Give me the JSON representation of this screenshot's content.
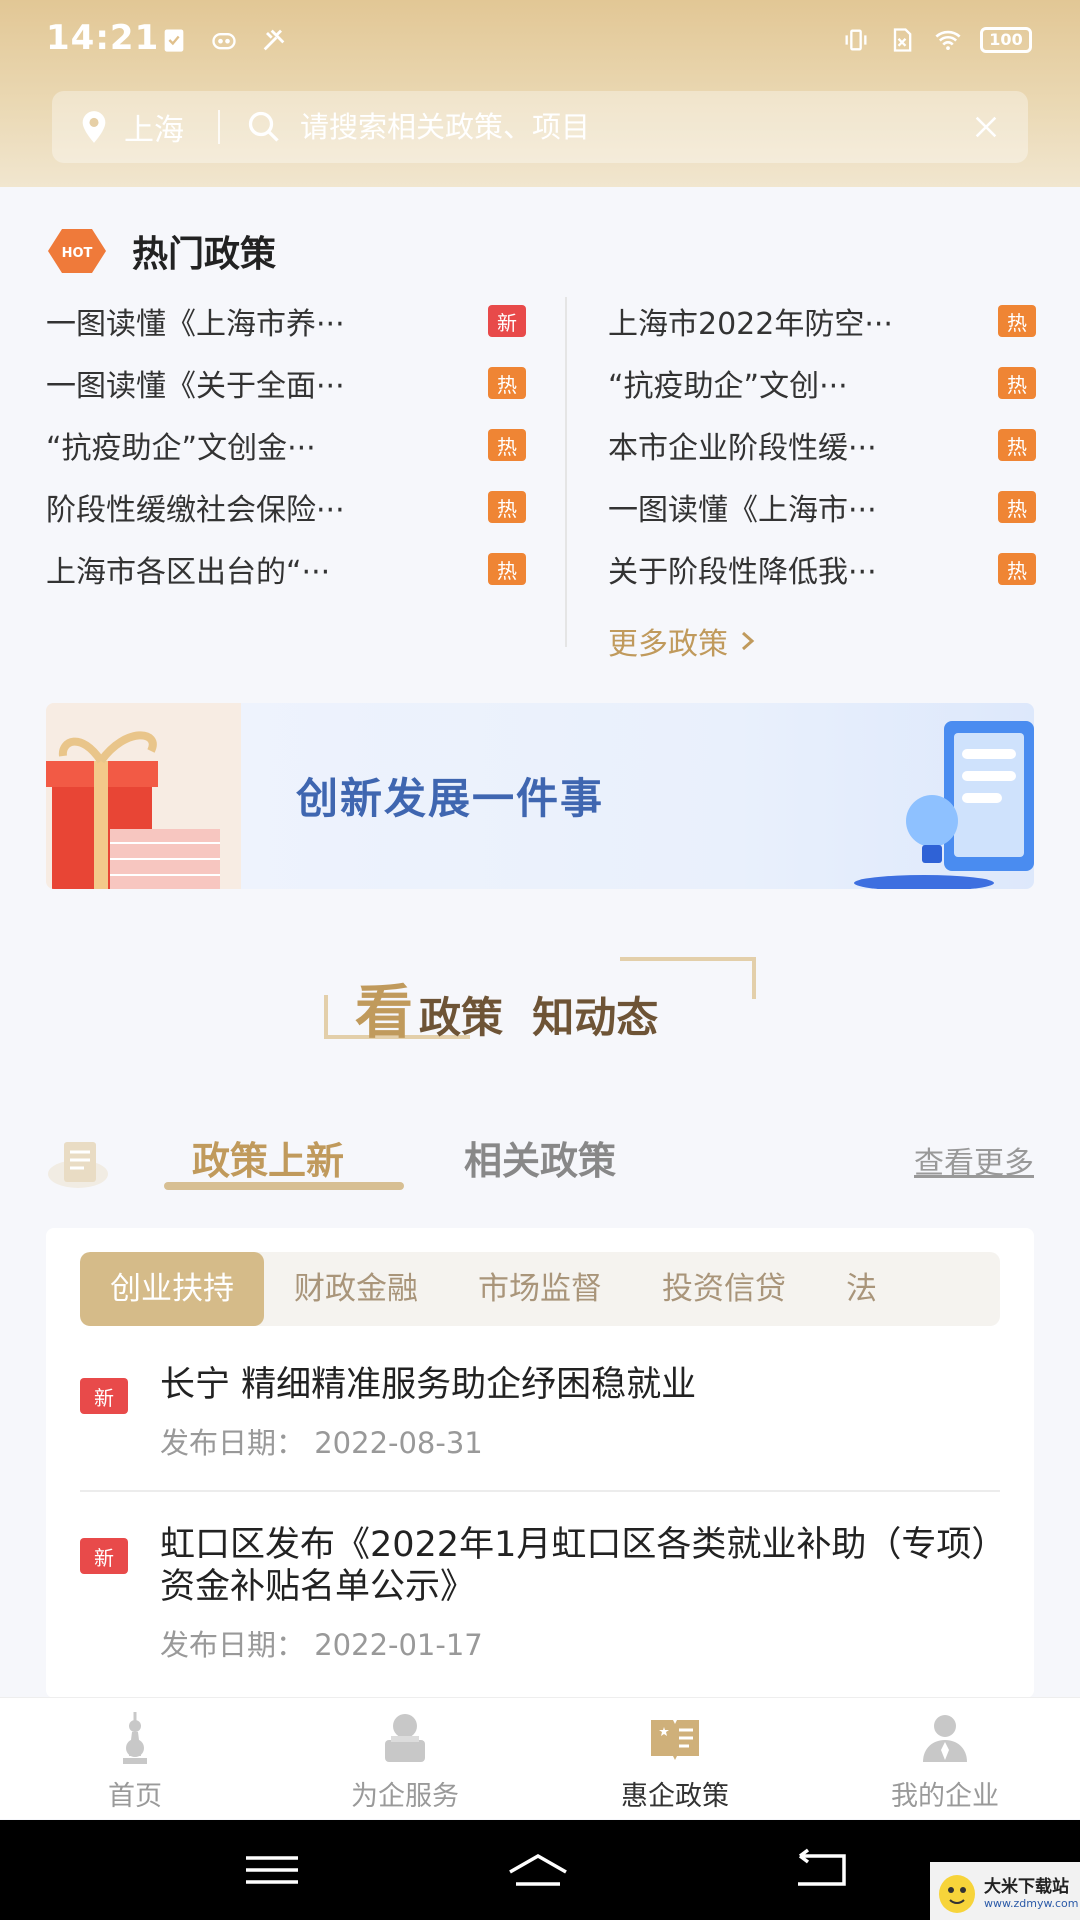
{
  "status": {
    "time": "14:21",
    "battery": "100"
  },
  "search": {
    "location": "上海",
    "placeholder": "请搜索相关政策、项目"
  },
  "hot": {
    "title": "热门政策",
    "badge": "HOT",
    "left": [
      {
        "text": "一图读懂《上海市养···",
        "tag": "新"
      },
      {
        "text": "一图读懂《关于全面···",
        "tag": "热"
      },
      {
        "text": "“抗疫助企”文创金···",
        "tag": "热"
      },
      {
        "text": "阶段性缓缴社会保险···",
        "tag": "热"
      },
      {
        "text": "上海市各区出台的“···",
        "tag": "热"
      }
    ],
    "right": [
      {
        "text": "上海市2022年防空···",
        "tag": "热"
      },
      {
        "text": "“抗疫助企”文创···",
        "tag": "热"
      },
      {
        "text": "本市企业阶段性缓···",
        "tag": "热"
      },
      {
        "text": "一图读懂《上海市···",
        "tag": "热"
      },
      {
        "text": "关于阶段性降低我···",
        "tag": "热"
      }
    ],
    "more": "更多政策"
  },
  "banner": {
    "text": "创新发展一件事"
  },
  "slogan": {
    "big": "看",
    "rest": "政策  知动态"
  },
  "tabs": {
    "active": "政策上新",
    "inactive": "相关政策",
    "view_more": "查看更多"
  },
  "categories": [
    "创业扶持",
    "财政金融",
    "市场监督",
    "投资信贷",
    "法"
  ],
  "news": [
    {
      "tag": "新",
      "title": "长宁 精细精准服务助企纾困稳就业",
      "date": "发布日期：  2022-08-31"
    },
    {
      "tag": "新",
      "title": "虹口区发布《2022年1月虹口区各类就业补助（专项）资金补贴名单公示》",
      "date": "发布日期：  2022-01-17"
    }
  ],
  "bottom_nav": [
    {
      "label": "首页",
      "icon": "tower-icon"
    },
    {
      "label": "为企服务",
      "icon": "service-icon"
    },
    {
      "label": "惠企政策",
      "icon": "policy-book-icon"
    },
    {
      "label": "我的企业",
      "icon": "user-enterprise-icon"
    }
  ],
  "watermark": {
    "name": "大米下载站",
    "url": "www.zdmyw.com"
  },
  "colors": {
    "gold": "#c09a5c",
    "new_tag": "#e84a4a",
    "hot_tag": "#ef8534",
    "banner_text": "#3f66b0"
  }
}
